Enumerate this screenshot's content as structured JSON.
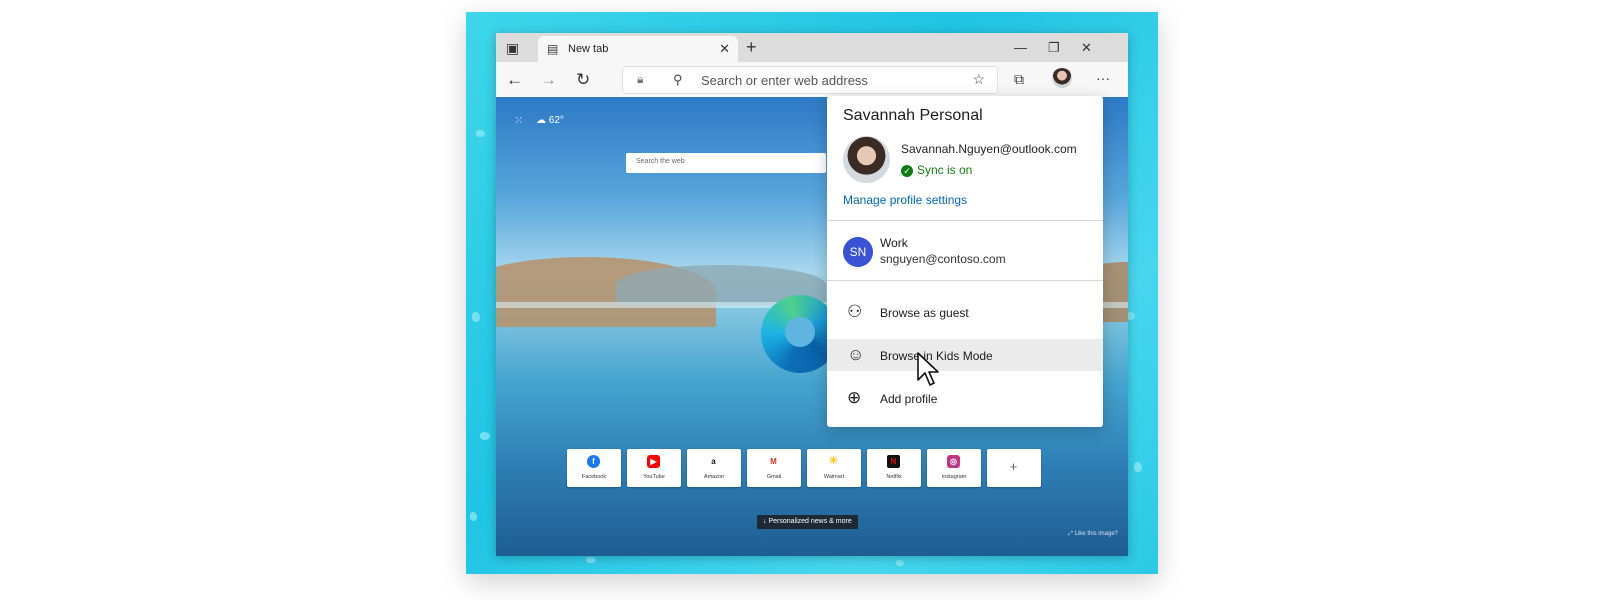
{
  "browser": {
    "tab_title": "New tab",
    "address_placeholder": "Search or enter web address"
  },
  "newtab": {
    "weather_temp": "62°",
    "search_placeholder": "Search the web",
    "quick_links": [
      "Facebook",
      "YouTube",
      "Amazon",
      "Gmail",
      "Walmart",
      "Netflix",
      "Instagram"
    ],
    "add_tile_glyph": "+",
    "news_button": "Personalized news & more",
    "like_image": "Like this image?"
  },
  "profile_menu": {
    "profile_name": "Savannah Personal",
    "email": "Savannah.Nguyen@outlook.com",
    "sync_status": "Sync is on",
    "manage_link": "Manage profile settings",
    "work_profile": {
      "initials": "SN",
      "name": "Work",
      "email": "snguyen@contoso.com"
    },
    "actions": [
      {
        "label": "Browse as guest",
        "icon": "guest-icon"
      },
      {
        "label": "Browse in Kids Mode",
        "icon": "kids-mode-icon"
      },
      {
        "label": "Add profile",
        "icon": "add-profile-icon"
      }
    ]
  },
  "colors": {
    "accent_link": "#0067b8",
    "sync_green": "#107c10",
    "work_avatar": "#3b52d4",
    "frame_teal": "#20c4e4"
  }
}
